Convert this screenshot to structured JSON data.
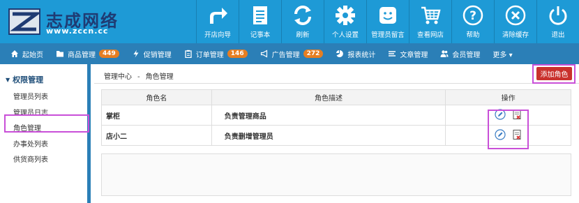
{
  "brand": {
    "title": "志成网络",
    "url": "www.zccn.cc"
  },
  "topnav": [
    {
      "label": "开店向导",
      "icon": "share-arrow-icon"
    },
    {
      "label": "记事本",
      "icon": "notepad-icon"
    },
    {
      "label": "刷新",
      "icon": "refresh-icon"
    },
    {
      "label": "个人设置",
      "icon": "gear-icon"
    },
    {
      "label": "管理员留言",
      "icon": "message-icon"
    },
    {
      "label": "查看网店",
      "icon": "cart-icon"
    },
    {
      "label": "帮助",
      "icon": "help-icon"
    },
    {
      "label": "清除缓存",
      "icon": "clear-icon"
    },
    {
      "label": "退出",
      "icon": "power-icon"
    }
  ],
  "menu": [
    {
      "label": "起始页",
      "icon": "home-icon",
      "badge": ""
    },
    {
      "label": "商品管理",
      "icon": "folder-icon",
      "badge": "449"
    },
    {
      "label": "促销管理",
      "icon": "bolt-icon",
      "badge": ""
    },
    {
      "label": "订单管理",
      "icon": "clipboard-icon",
      "badge": "146"
    },
    {
      "label": "广告管理",
      "icon": "megaphone-icon",
      "badge": "272"
    },
    {
      "label": "报表统计",
      "icon": "pie-icon",
      "badge": ""
    },
    {
      "label": "文章管理",
      "icon": "list-icon",
      "badge": ""
    },
    {
      "label": "会员管理",
      "icon": "users-icon",
      "badge": ""
    },
    {
      "label": "更多 ▾",
      "icon": "",
      "badge": ""
    }
  ],
  "sidebar": {
    "heading": "权限管理",
    "items": [
      "管理员列表",
      "管理员日志",
      "角色管理",
      "办事处列表",
      "供货商列表"
    ]
  },
  "breadcrumb": {
    "root": "管理中心",
    "sep": "-",
    "current": "角色管理"
  },
  "add_button": "添加角色",
  "table": {
    "headers": [
      "角色名",
      "角色描述",
      "操作"
    ],
    "rows": [
      {
        "name": "掌柜",
        "desc": "负责管理商品"
      },
      {
        "name": "店小二",
        "desc": "负责删增管理员"
      }
    ]
  },
  "colors": {
    "topbar": "#1e9ad6",
    "menubar": "#2b7fb7",
    "badge": "#e67e22",
    "add_button": "#c9302c",
    "highlight": "#c94fd8"
  }
}
